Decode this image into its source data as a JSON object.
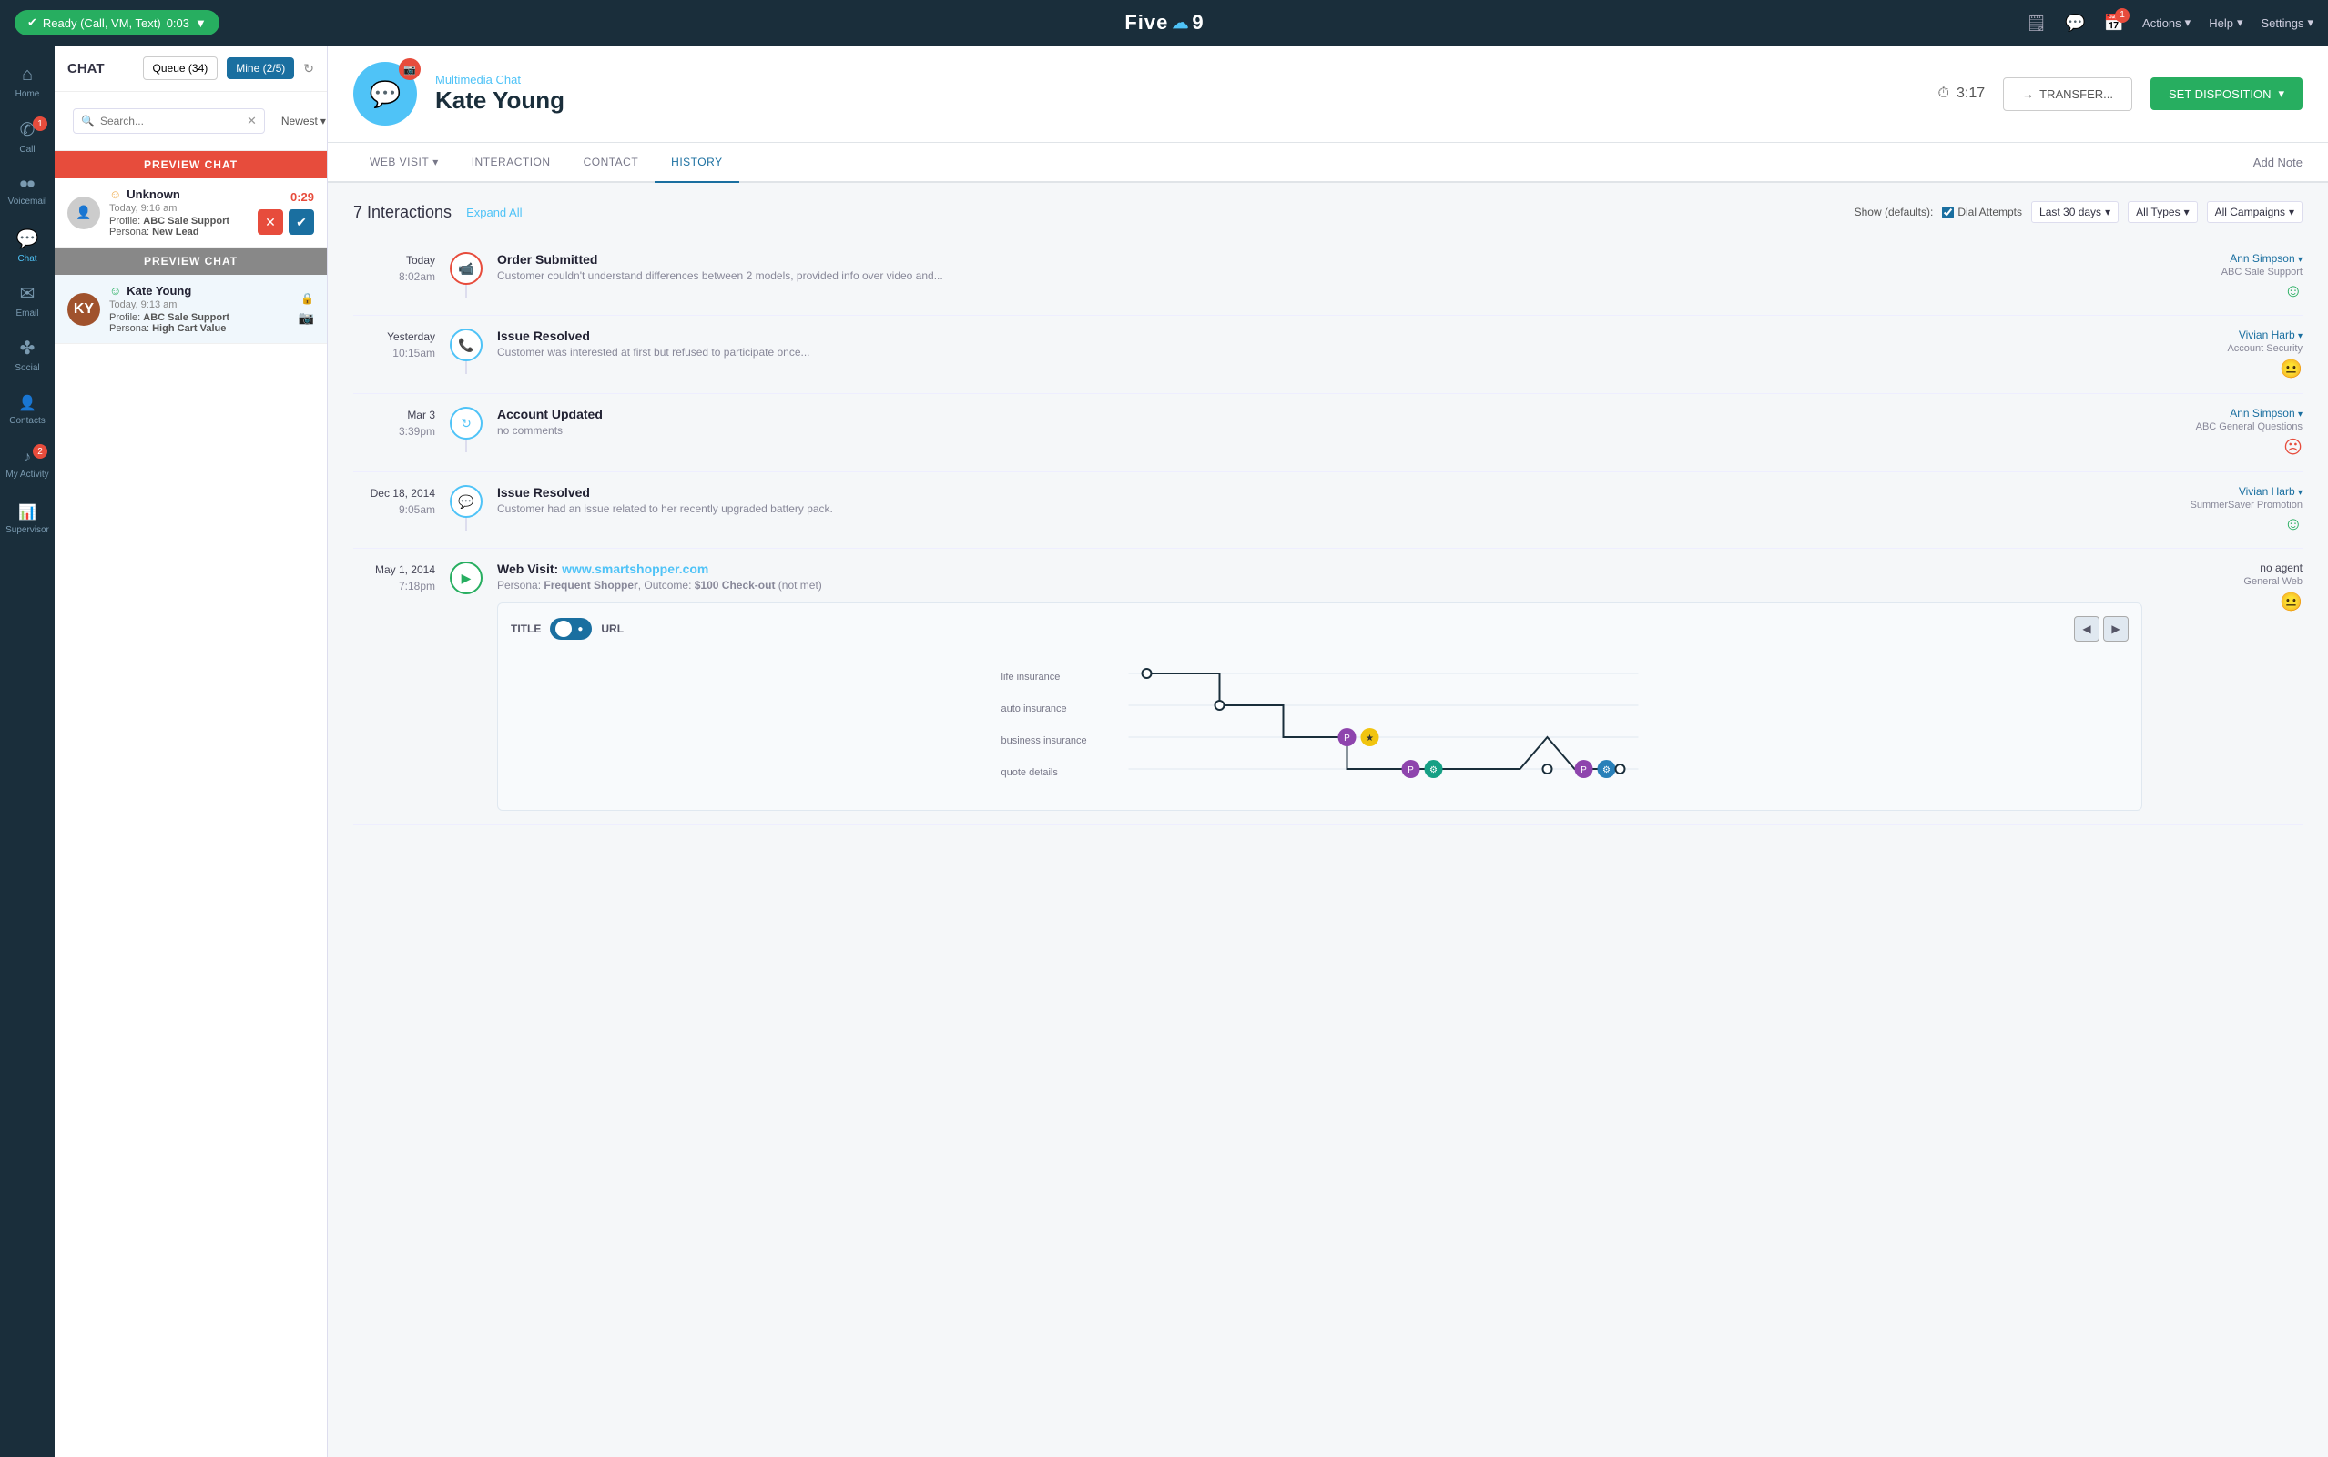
{
  "topNav": {
    "readyLabel": "Ready (Call, VM, Text)",
    "timerLabel": "0:03",
    "logoText": "Five9",
    "actionsLabel": "Actions",
    "helpLabel": "Help",
    "settingsLabel": "Settings",
    "notifBadge": "1"
  },
  "sidebar": {
    "items": [
      {
        "label": "Home",
        "icon": "⌂",
        "active": false,
        "badge": null
      },
      {
        "label": "Call",
        "icon": "✆",
        "active": false,
        "badge": "1"
      },
      {
        "label": "Voicemail",
        "icon": "●",
        "active": false,
        "badge": null
      },
      {
        "label": "Chat",
        "icon": "💬",
        "active": true,
        "badge": null
      },
      {
        "label": "Email",
        "icon": "✉",
        "active": false,
        "badge": null
      },
      {
        "label": "Social",
        "icon": "✤",
        "active": false,
        "badge": null
      },
      {
        "label": "Contacts",
        "icon": "👤",
        "active": false,
        "badge": null
      },
      {
        "label": "My Activity",
        "icon": "♪",
        "active": false,
        "badge": "2"
      },
      {
        "label": "Supervisor",
        "icon": "📊",
        "active": false,
        "badge": null
      }
    ]
  },
  "chatPanel": {
    "title": "CHAT",
    "queueLabel": "Queue (34)",
    "mineLabel": "Mine (2/5)",
    "searchPlaceholder": "Search...",
    "sortLabel": "Newest",
    "previewChats": [
      {
        "type": "preview",
        "labelText": "PREVIEW CHAT",
        "labelColor": "red",
        "name": "Unknown",
        "time": "Today, 9:16 am",
        "profile": "ABC Sale Support",
        "persona": "New Lead",
        "timer": "0:29",
        "hasActions": true
      },
      {
        "type": "preview",
        "labelText": "PREVIEW CHAT",
        "labelColor": "gray",
        "name": "Kate Young",
        "time": "Today, 9:13 am",
        "profile": "ABC Sale Support",
        "persona": "High Cart Value",
        "timer": null,
        "hasActions": false,
        "active": true
      }
    ]
  },
  "contactHeader": {
    "type": "Multimedia Chat",
    "name": "Kate Young",
    "timer": "3:17",
    "transferLabel": "TRANSFER...",
    "setDispositionLabel": "SET DISPOSITION"
  },
  "tabs": {
    "items": [
      "WEB VISIT",
      "INTERACTION",
      "CONTACT",
      "HISTORY"
    ],
    "activeIndex": 3,
    "addNoteLabel": "Add Note"
  },
  "history": {
    "countLabel": "7 Interactions",
    "expandAllLabel": "Expand All",
    "showLabel": "Show (defaults):",
    "dialAttemptsLabel": "Dial Attempts",
    "lastDaysLabel": "Last 30 days",
    "allTypesLabel": "All Types",
    "allCampaignsLabel": "All Campaigns",
    "interactions": [
      {
        "dateTop": "Today",
        "dateBottom": "8:02am",
        "iconType": "video",
        "title": "Order Submitted",
        "desc": "Customer couldn't understand differences between 2 models, provided info over video and...",
        "agentName": "Ann Simpson",
        "campaign": "ABC Sale Support",
        "sentiment": "happy"
      },
      {
        "dateTop": "Yesterday",
        "dateBottom": "10:15am",
        "iconType": "call",
        "title": "Issue Resolved",
        "desc": "Customer was interested at first but refused to participate once...",
        "agentName": "Vivian Harb",
        "campaign": "Account Security",
        "sentiment": "neutral"
      },
      {
        "dateTop": "Mar 3",
        "dateBottom": "3:39pm",
        "iconType": "refresh",
        "title": "Account Updated",
        "desc": "no comments",
        "agentName": "Ann Simpson",
        "campaign": "ABC General Questions",
        "sentiment": "sad"
      },
      {
        "dateTop": "Dec 18, 2014",
        "dateBottom": "9:05am",
        "iconType": "chat",
        "title": "Issue Resolved",
        "desc": "Customer had an issue related to her recently upgraded battery pack.",
        "agentName": "Vivian Harb",
        "campaign": "SummerSaver Promotion",
        "sentiment": "happy"
      },
      {
        "dateTop": "May 1, 2014",
        "dateBottom": "7:18pm",
        "iconType": "nav",
        "title": "Web Visit:",
        "titleLink": "www.smartshopper.com",
        "desc": "Persona: Frequent Shopper, Outcome: $100 Check-out (not met)",
        "agentName": "no agent",
        "campaign": "General Web",
        "sentiment": "neutral",
        "hasWebVisit": true
      }
    ]
  },
  "webVisit": {
    "titleLabel": "TITLE",
    "urlLabel": "URL",
    "journeyRows": [
      {
        "label": "life insurance",
        "dotPos": 15
      },
      {
        "label": "auto insurance",
        "dotPos": 30
      },
      {
        "label": "business insurance",
        "dotPos": 55,
        "markers": [
          {
            "type": "purple",
            "pos": 52
          },
          {
            "type": "yellow",
            "pos": 58
          }
        ]
      },
      {
        "label": "quote details",
        "dotPos": 70,
        "markers": [
          {
            "type": "purple",
            "pos": 68
          },
          {
            "type": "teal",
            "pos": 75
          },
          {
            "type": "purple",
            "pos": 88
          },
          {
            "type": "gear",
            "pos": 95
          }
        ]
      }
    ]
  }
}
